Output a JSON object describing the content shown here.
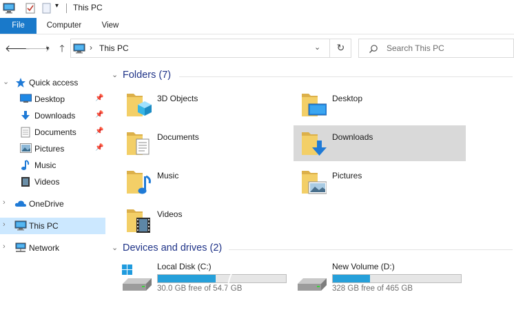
{
  "window": {
    "title": "This PC"
  },
  "ribbon": {
    "tabs": [
      "File",
      "Computer",
      "View"
    ]
  },
  "address": {
    "path": "This PC"
  },
  "search": {
    "placeholder": "Search This PC"
  },
  "nav": {
    "quick_access": "Quick access",
    "quick_items": [
      "Desktop",
      "Downloads",
      "Documents",
      "Pictures",
      "Music",
      "Videos"
    ],
    "onedrive": "OneDrive",
    "this_pc": "This PC",
    "network": "Network"
  },
  "folders": {
    "header": "Folders (7)",
    "items": [
      "3D Objects",
      "Desktop",
      "Documents",
      "Downloads",
      "Music",
      "Pictures",
      "Videos"
    ]
  },
  "drives": {
    "header": "Devices and drives (2)",
    "items": [
      {
        "name": "Local Disk (C:)",
        "free": "30.0 GB free of 54.7 GB",
        "used_fraction": 0.45
      },
      {
        "name": "New Volume (D:)",
        "free": "328 GB free of 465 GB",
        "used_fraction": 0.29
      }
    ]
  },
  "colors": {
    "accent": "#1979ca",
    "selection": "#cce8ff",
    "drive_bar": "#26a0da",
    "header_text": "#1e3287"
  }
}
